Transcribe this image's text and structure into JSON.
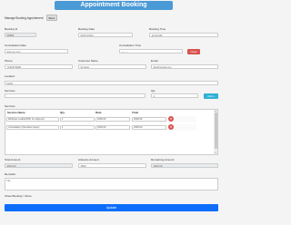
{
  "header": {
    "title": "Appointment Booking"
  },
  "top": {
    "manage_label": "Manage Booking Appointment",
    "back_label": "Back"
  },
  "booking": {
    "id_label": "Booking Id",
    "id_value": "59886",
    "date_label": "Booking Date",
    "date_value": "06/07/2024",
    "time_label": "Booking Time",
    "time_value": "12:00 AM"
  },
  "consultation": {
    "date_label": "Consultation Date",
    "date_value": "dd-mm-yyyy",
    "time_label": "Consultation Time",
    "time_value": "--:-- --",
    "clear_label": "Clear"
  },
  "customer": {
    "phone_label": "Phone",
    "phone_value": "7159976984",
    "name_label": "Customer Name",
    "name_value": "Smitrek",
    "email_label": "Email",
    "email_value": "abc@gmail.com"
  },
  "location": {
    "label": "Location",
    "value": "Delhi"
  },
  "service_select": {
    "label": "Services",
    "value": "",
    "qty_label": "Qty",
    "qty_value": "1",
    "add_label": "Add +"
  },
  "services": {
    "section_label": "Services",
    "columns": [
      "Service Name",
      "Qty",
      "Rate",
      "Total"
    ],
    "rows": [
      {
        "name": "Wellness Leaflet(PDF for subjects)",
        "qty": "1",
        "rate": "2000.00",
        "total": "2000.00"
      },
      {
        "name": "Consultation (Sensitive Issue)",
        "qty": "1",
        "rate": "2000.00",
        "total": "2000.00"
      }
    ]
  },
  "amounts": {
    "total_label": "Total Amount",
    "total_value": "4000.00",
    "advance_label": "Advance Amount",
    "advance_value": "3500",
    "remaining_label": "Remaining Amount",
    "remaining_value": "4000.00"
  },
  "remarks": {
    "label": "Remarks",
    "value": "NA"
  },
  "status": {
    "label": "Close Booking / Close"
  },
  "footer": {
    "update_label": "Update"
  },
  "colors": {
    "banner": "#4a9ad6",
    "clear": "#d9534f",
    "add": "#31b0d5",
    "update": "#0d6efd"
  }
}
